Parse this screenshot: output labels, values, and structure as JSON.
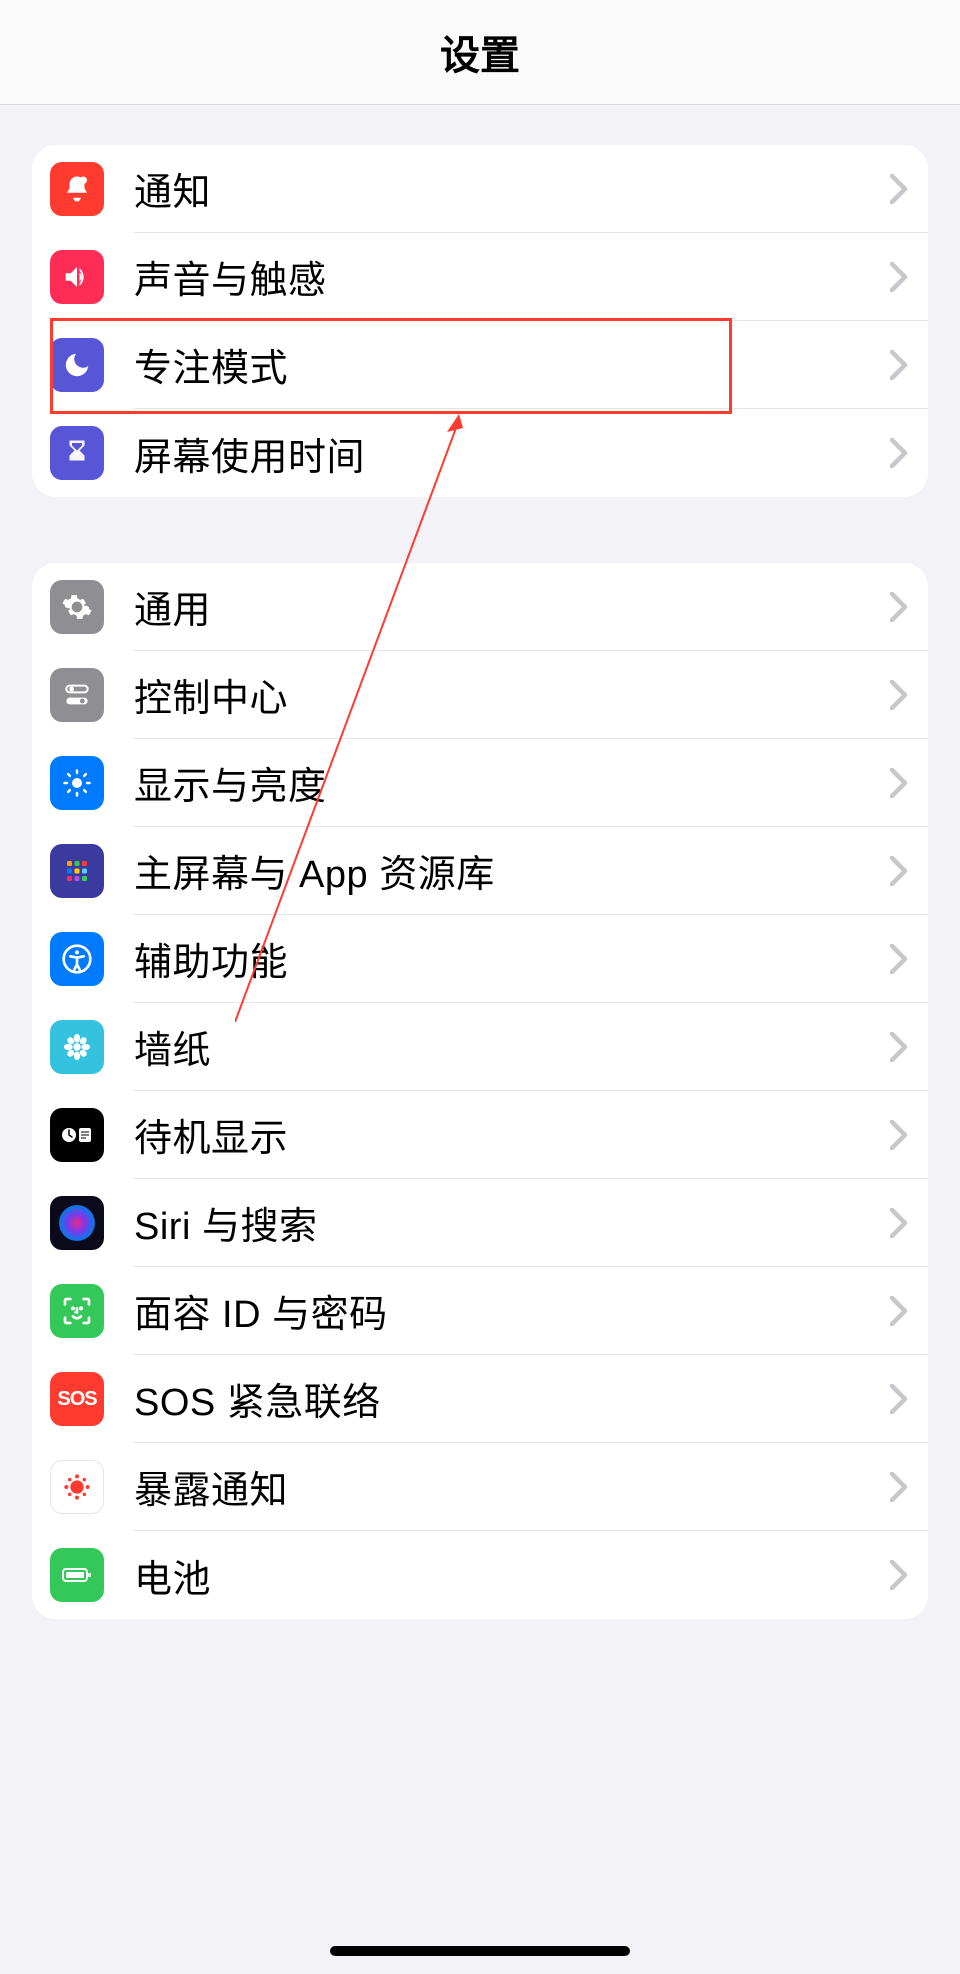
{
  "header": {
    "title": "设置"
  },
  "group1": {
    "items": [
      {
        "label": "通知",
        "icon_bg": "#ff3b30",
        "icon": "bell"
      },
      {
        "label": "声音与触感",
        "icon_bg": "#ff2d55",
        "icon": "speaker"
      },
      {
        "label": "专注模式",
        "icon_bg": "#5856d6",
        "icon": "moon"
      },
      {
        "label": "屏幕使用时间",
        "icon_bg": "#5856d6",
        "icon": "hourglass"
      }
    ]
  },
  "group2": {
    "items": [
      {
        "label": "通用",
        "icon_bg": "#8e8e93",
        "icon": "gear"
      },
      {
        "label": "控制中心",
        "icon_bg": "#8e8e93",
        "icon": "toggles"
      },
      {
        "label": "显示与亮度",
        "icon_bg": "#007aff",
        "icon": "sun"
      },
      {
        "label": "主屏幕与 App 资源库",
        "icon_bg": "#3a3a9f",
        "icon": "apps"
      },
      {
        "label": "辅助功能",
        "icon_bg": "#007aff",
        "icon": "accessibility"
      },
      {
        "label": "墙纸",
        "icon_bg": "#34c2de",
        "icon": "flower"
      },
      {
        "label": "待机显示",
        "icon_bg": "#000000",
        "icon": "standby"
      },
      {
        "label": "Siri 与搜索",
        "icon_bg": "siri",
        "icon": "siri"
      },
      {
        "label": "面容 ID 与密码",
        "icon_bg": "#34c759",
        "icon": "faceid"
      },
      {
        "label": "SOS 紧急联络",
        "icon_bg": "#ff3b30",
        "icon": "sos"
      },
      {
        "label": "暴露通知",
        "icon_bg": "#ffffff",
        "icon": "exposure"
      },
      {
        "label": "电池",
        "icon_bg": "#34c759",
        "icon": "battery"
      }
    ]
  },
  "annotation": {
    "highlighted_item": "专注模式"
  }
}
